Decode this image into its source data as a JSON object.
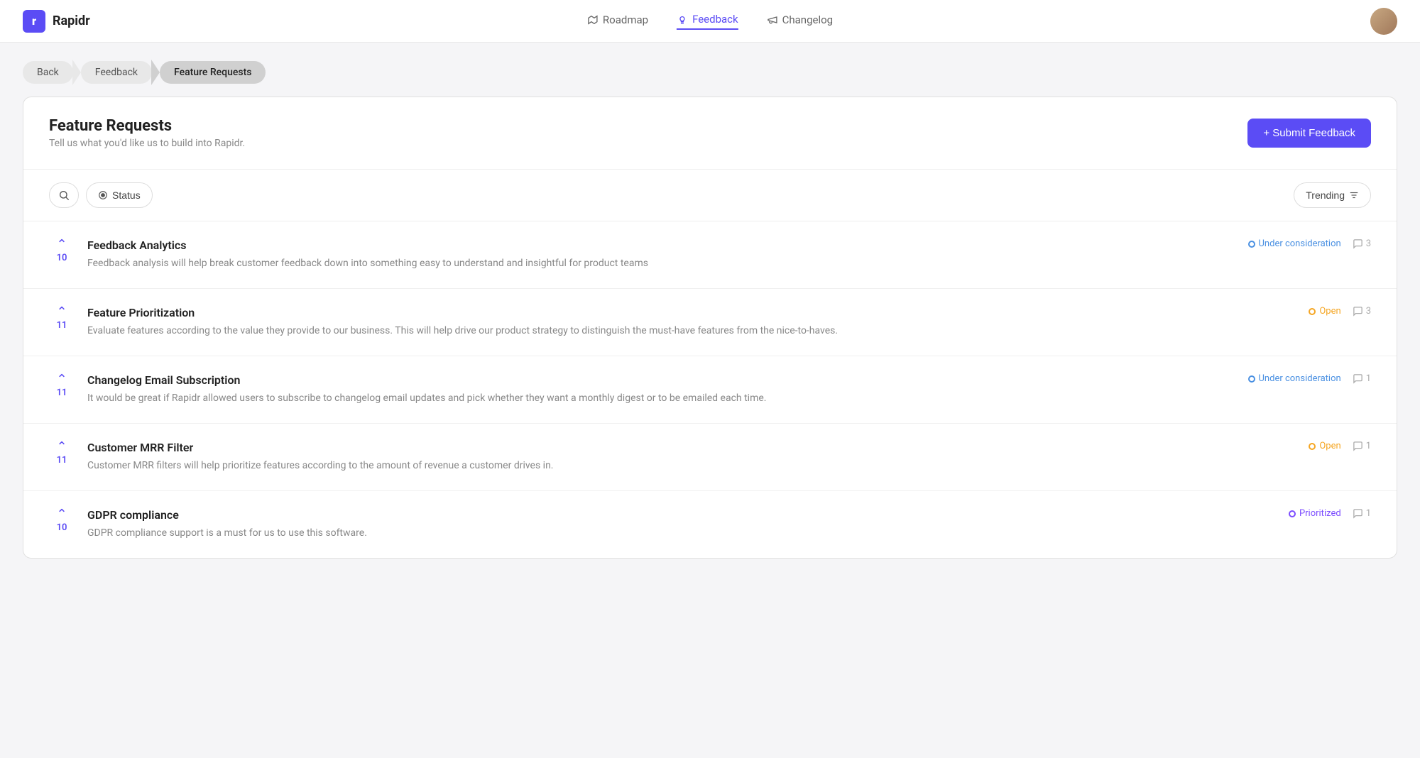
{
  "app": {
    "logo_letter": "r",
    "name": "Rapidr"
  },
  "nav": {
    "items": [
      {
        "id": "roadmap",
        "label": "Roadmap",
        "icon": "map",
        "active": false
      },
      {
        "id": "feedback",
        "label": "Feedback",
        "icon": "lightbulb",
        "active": true
      },
      {
        "id": "changelog",
        "label": "Changelog",
        "icon": "megaphone",
        "active": false
      }
    ]
  },
  "breadcrumb": {
    "items": [
      {
        "id": "back",
        "label": "Back",
        "active": false
      },
      {
        "id": "feedback",
        "label": "Feedback",
        "active": false
      },
      {
        "id": "feature-requests",
        "label": "Feature Requests",
        "active": true
      }
    ]
  },
  "page": {
    "title": "Feature Requests",
    "subtitle": "Tell us what you'd like us to build into Rapidr.",
    "submit_btn": "+ Submit Feedback"
  },
  "filters": {
    "status_label": "Status",
    "trending_label": "Trending"
  },
  "feed": {
    "items": [
      {
        "id": "feedback-analytics",
        "title": "Feedback Analytics",
        "description": "Feedback analysis will help break customer feedback down into something easy to understand and insightful for product teams",
        "votes": 10,
        "status": "Under consideration",
        "status_color": "blue",
        "comment_count": 3
      },
      {
        "id": "feature-prioritization",
        "title": "Feature Prioritization",
        "description": "Evaluate features according to the value they provide to our business. This will help drive our product strategy to distinguish the must-have features from the nice-to-haves.",
        "votes": 11,
        "status": "Open",
        "status_color": "orange",
        "comment_count": 3
      },
      {
        "id": "changelog-email-subscription",
        "title": "Changelog Email Subscription",
        "description": "It would be great if Rapidr allowed users to subscribe to changelog email updates and pick whether they want a monthly digest or to be emailed each time.",
        "votes": 11,
        "status": "Under consideration",
        "status_color": "blue",
        "comment_count": 1
      },
      {
        "id": "customer-mrr-filter",
        "title": "Customer MRR Filter",
        "description": "Customer MRR filters will help prioritize features according to the amount of revenue a customer drives in.",
        "votes": 11,
        "status": "Open",
        "status_color": "orange",
        "comment_count": 1
      },
      {
        "id": "gdpr-compliance",
        "title": "GDPR compliance",
        "description": "GDPR compliance support is a must for us to use this software.",
        "votes": 10,
        "status": "Prioritized",
        "status_color": "purple",
        "comment_count": 1
      }
    ]
  }
}
